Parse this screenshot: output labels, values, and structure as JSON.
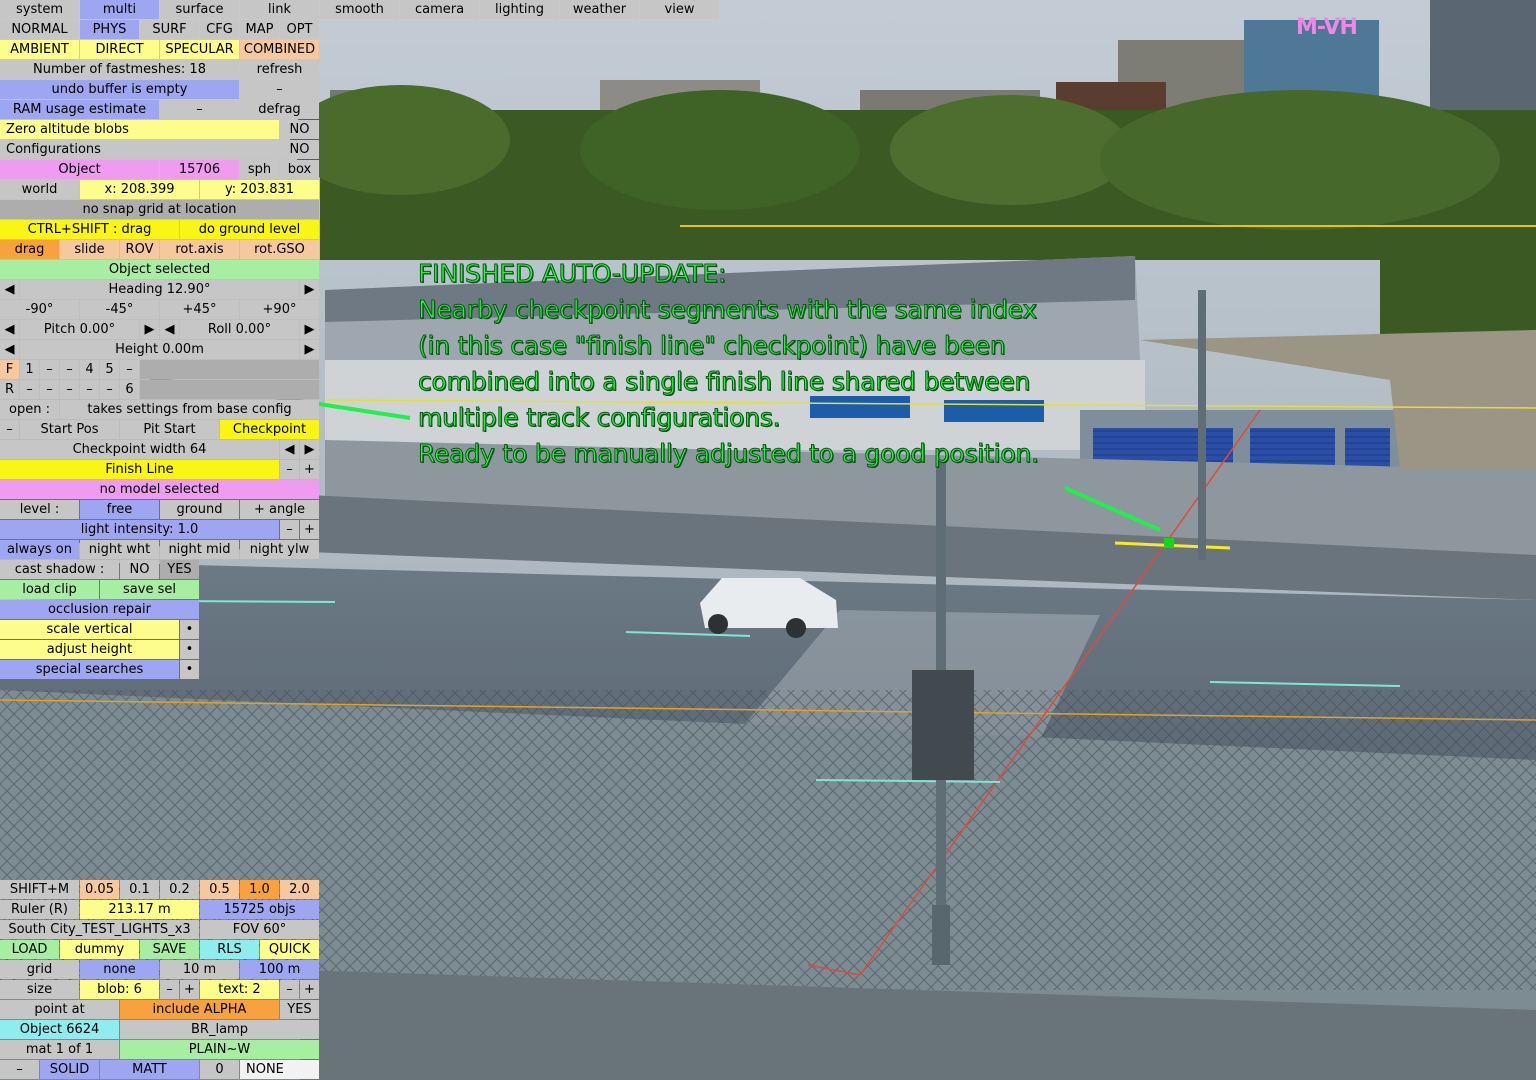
{
  "colors": {
    "panel_gray": "#c6c6c6",
    "panel_blue": "#9ea6f2",
    "panel_yellow": "#fdfd8e",
    "panel_bright_yellow": "#f9f514",
    "panel_green": "#a8eea2",
    "panel_pink": "#ef9cf0",
    "panel_orange": "#f6c89d",
    "overlay_text": "#2cf24a"
  },
  "watermark": "M-VH",
  "tabs": [
    "system",
    "multi",
    "surface",
    "link",
    "smooth",
    "camera",
    "lighting",
    "weather",
    "view"
  ],
  "modes": [
    "NORMAL",
    "PHYS",
    "SURF",
    "CFG",
    "MAP",
    "OPT"
  ],
  "light": [
    "AMBIENT",
    "DIRECT",
    "SPECULAR",
    "COMBINED"
  ],
  "panel": {
    "fastmeshes": "Number of fastmeshes: 18",
    "refresh": "refresh",
    "undo": "undo buffer is empty",
    "undo_dash": "–",
    "ram": "RAM usage estimate",
    "ram_dash": "–",
    "defrag": "defrag",
    "zero_alt": "Zero altitude blobs",
    "zero_alt_val": "NO",
    "configs": "Configurations",
    "configs_val": "NO",
    "object": "Object",
    "object_id": "15706",
    "sph": "sph",
    "box": "box",
    "world": "world",
    "x": "x: 208.399",
    "y": "y: 203.831",
    "snap": "no snap grid at location",
    "ctrl_shift": "CTRL+SHIFT : drag",
    "ground_level": "do ground level",
    "drag": "drag",
    "slide": "slide",
    "rov": "ROV",
    "rot_axis": "rot.axis",
    "rot_gso": "rot.GSO",
    "object_selected": "Object selected",
    "heading": "Heading 12.90°",
    "angles": [
      "-90°",
      "-45°",
      "+45°",
      "+90°"
    ],
    "pitch": "Pitch 0.00°",
    "roll": "Roll 0.00°",
    "height": "Height 0.00m",
    "f_row": [
      "F",
      "1",
      "–",
      "–",
      "4",
      "5",
      "–"
    ],
    "r_row": [
      "R",
      "–",
      "–",
      "–",
      "–",
      "–",
      "6"
    ],
    "open": "open :",
    "takes_settings": "takes settings from base config",
    "start_dash": "–",
    "start_pos": "Start Pos",
    "pit_start": "Pit Start",
    "checkpoint": "Checkpoint",
    "cp_width": "Checkpoint width 64",
    "finish_line": "Finish Line",
    "minus": "–",
    "plus": "+",
    "no_model": "no model selected",
    "level": "level :",
    "free": "free",
    "ground": "ground",
    "plus_angle": "+ angle",
    "light_intensity": "light intensity: 1.0",
    "always_on": "always on",
    "night_wht": "night wht",
    "night_mid": "night mid",
    "night_ylw": "night ylw",
    "cast_shadow": "cast shadow :",
    "no": "NO",
    "yes": "YES",
    "load_clip": "load clip",
    "save_sel": "save sel",
    "occlusion": "occlusion repair",
    "scale_vertical": "scale vertical",
    "adjust_height": "adjust height",
    "special_searches": "special searches",
    "bullet": "•"
  },
  "bottom": {
    "shift_m": "SHIFT+M",
    "steps": [
      "0.05",
      "0.1",
      "0.2",
      "0.5",
      "1.0",
      "2.0"
    ],
    "ruler": "Ruler (R)",
    "ruler_val": "213.17 m",
    "objs": "15725 objs",
    "track": "South City_TEST_LIGHTS_x3",
    "fov": "FOV 60°",
    "load": "LOAD",
    "dummy": "dummy",
    "save": "SAVE",
    "rls": "RLS",
    "quick": "QUICK",
    "grid": "grid",
    "grid_none": "none",
    "grid_10": "10 m",
    "grid_100": "100 m",
    "size": "size",
    "blob": "blob: 6",
    "text": "text: 2",
    "minus": "–",
    "plus": "+",
    "point_at": "point at",
    "include_alpha": "include ALPHA",
    "yes": "YES",
    "object2": "Object 6624",
    "br_lamp": "BR_lamp",
    "mat": "mat 1 of 1",
    "plain": "PLAIN~W",
    "dash": "–",
    "solid": "SOLID",
    "matt": "MATT",
    "zero": "0",
    "none": "NONE"
  },
  "overlay_lines": [
    "FINISHED AUTO-UPDATE:",
    "Nearby checkpoint segments with the same index",
    "(in this case \"finish line\" checkpoint) have been",
    "combined into a single finish line shared between",
    "multiple track configurations.",
    "Ready to be manually adjusted to a good position."
  ]
}
